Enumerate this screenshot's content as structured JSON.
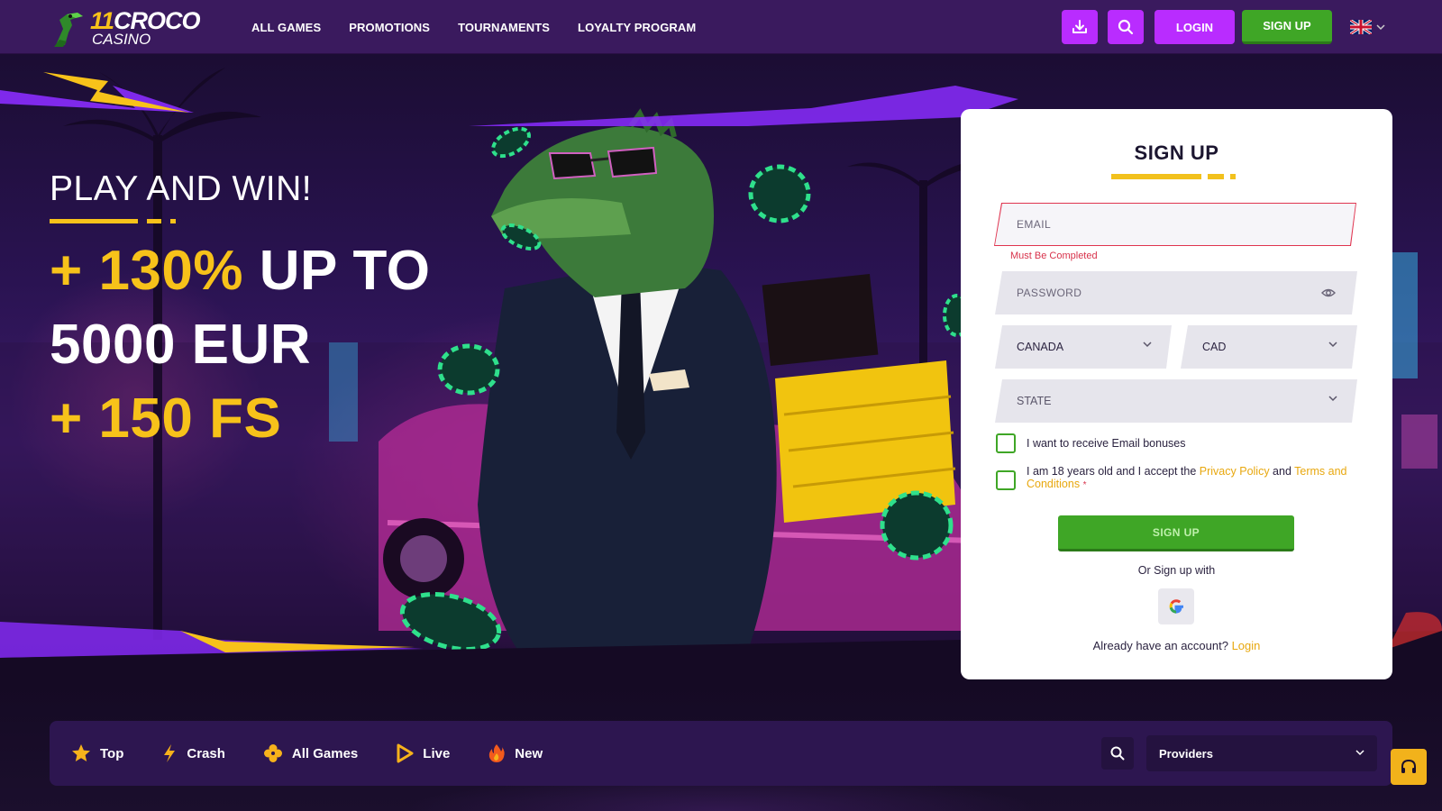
{
  "header": {
    "logo": {
      "number": "11",
      "name": "CROCO",
      "sub": "CASINO"
    },
    "nav": [
      "ALL GAMES",
      "PROMOTIONS",
      "TOURNAMENTS",
      "LOYALTY PROGRAM"
    ],
    "login_label": "LOGIN",
    "signup_label": "SIGN UP",
    "language_icon": "uk-flag-icon"
  },
  "hero": {
    "heading": "PLAY AND WIN!",
    "offer_plus_1": "+ ",
    "offer_percent": "130%",
    "offer_up_to": " UP TO",
    "offer_amount": "5000 EUR",
    "offer_fs": "+ 150 FS"
  },
  "signup_form": {
    "title": "SIGN UP",
    "email_placeholder": "EMAIL",
    "email_error": "Must Be Completed",
    "password_placeholder": "PASSWORD",
    "country_value": "CANADA",
    "currency_value": "CAD",
    "state_placeholder": "STATE",
    "email_bonus_label": "I want to receive Email bonuses",
    "terms_prefix": "I am 18 years old and I accept the ",
    "privacy_link": "Privacy Policy",
    "terms_and": " and ",
    "terms_link": "Terms and Conditions",
    "required_mark": "*",
    "submit_label": "SIGN UP",
    "or_text": "Or Sign up with",
    "already_text": "Already have an account? ",
    "login_link": "Login"
  },
  "categories": {
    "items": [
      {
        "label": "Top",
        "icon": "star-icon"
      },
      {
        "label": "Crash",
        "icon": "lightning-icon"
      },
      {
        "label": "All Games",
        "icon": "clover-icon"
      },
      {
        "label": "Live",
        "icon": "play-icon"
      },
      {
        "label": "New",
        "icon": "fire-icon"
      }
    ],
    "providers_label": "Providers"
  },
  "colors": {
    "header_bg": "#3a1a5e",
    "accent_purple": "#b92cff",
    "accent_green": "#3fa626",
    "accent_yellow": "#f7c21a",
    "error_red": "#d8324b"
  }
}
